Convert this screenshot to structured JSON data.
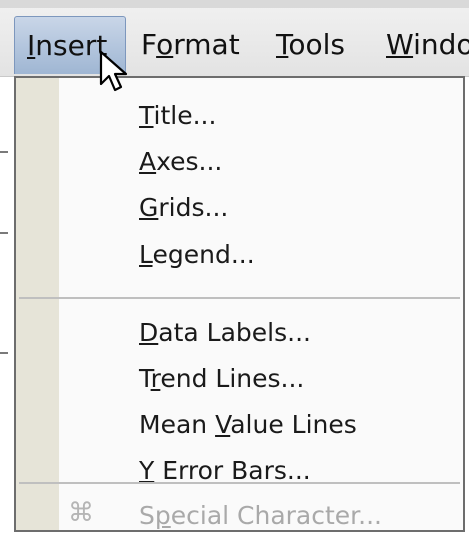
{
  "menubar": {
    "items": [
      {
        "pre": "",
        "key": "I",
        "post": "nsert",
        "active": true
      },
      {
        "pre": "F",
        "key": "o",
        "post": "rmat"
      },
      {
        "pre": "",
        "key": "T",
        "post": "ools"
      },
      {
        "pre": "",
        "key": "W",
        "post": "indo"
      }
    ]
  },
  "dropdown": {
    "groups": [
      [
        {
          "pre": "",
          "key": "T",
          "post": "itle..."
        },
        {
          "pre": "",
          "key": "A",
          "post": "xes..."
        },
        {
          "pre": "",
          "key": "G",
          "post": "rids..."
        },
        {
          "pre": "",
          "key": "L",
          "post": "egend..."
        }
      ],
      [
        {
          "pre": "",
          "key": "D",
          "post": "ata Labels..."
        },
        {
          "pre": "T",
          "key": "r",
          "post": "end Lines..."
        },
        {
          "pre": "Mean ",
          "key": "V",
          "post": "alue Lines"
        },
        {
          "pre": "",
          "key": "Y",
          "post": " Error Bars..."
        }
      ],
      [
        {
          "pre": "S",
          "key": "p",
          "post": "ecial Character...",
          "disabled": true,
          "icon": "command-key-icon",
          "glyph": "⌘"
        }
      ]
    ]
  }
}
